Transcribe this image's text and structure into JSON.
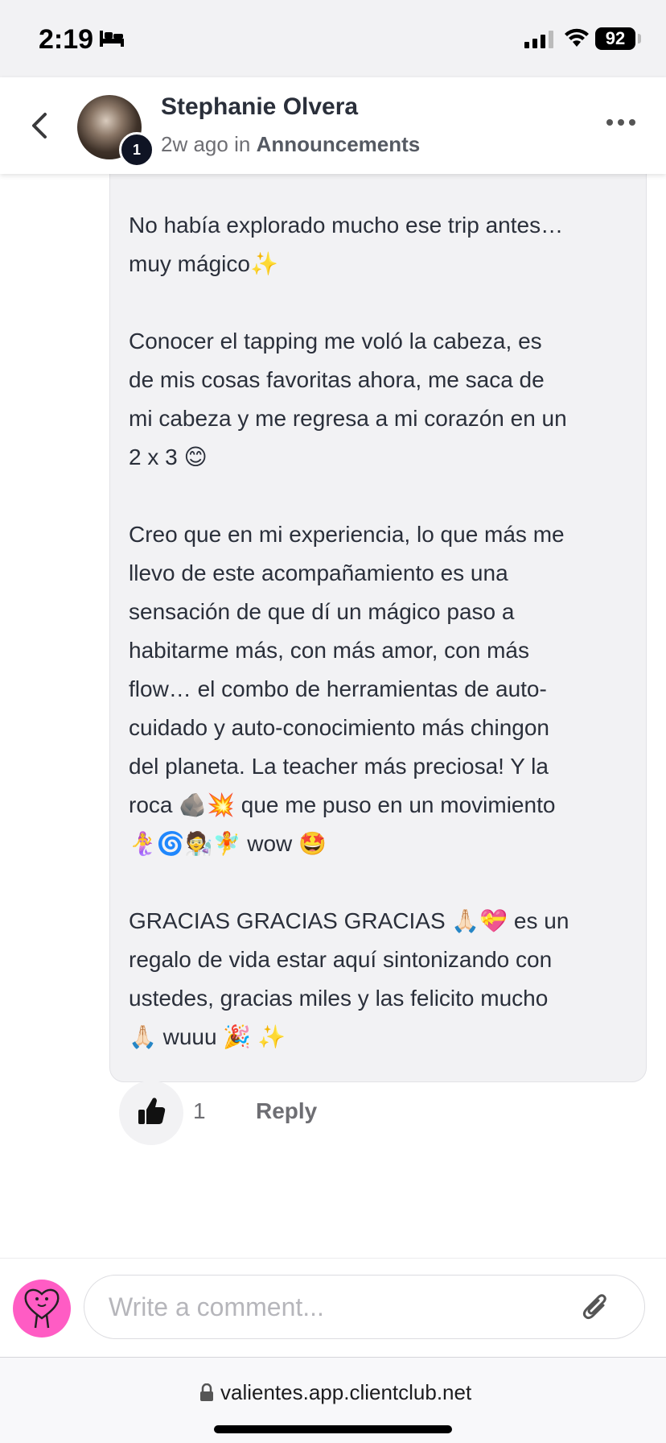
{
  "status_bar": {
    "time": "2:19",
    "battery": "92"
  },
  "header": {
    "author": "Stephanie Olvera",
    "badge": "1",
    "time_ago": "2w ago",
    "in_word": "in",
    "category": "Announcements"
  },
  "comment": {
    "paragraphs": [
      "No había explorado mucho ese trip antes…\nmuy mágico✨",
      "Conocer el tapping me voló la cabeza, es\nde mis cosas favoritas ahora, me saca de\nmi cabeza y me regresa a mi corazón en un\n2 x 3 😊",
      "Creo que en mi experiencia, lo que más me\nllevo de este acompañamiento es una\nsensación de que dí un mágico paso a\nhabitarme más, con más amor, con más\nflow… el combo de herramientas de auto-\ncuidado y auto-conocimiento más chingon\ndel planeta. La teacher más preciosa! Y la\nroca 🪨💥 que me puso en un movimiento\n🧜‍♀️🌀🧑‍🔬🧚 wow 🤩",
      "GRACIAS GRACIAS GRACIAS 🙏🏻💝 es un\nregalo de vida estar aquí sintonizando con\nustedes, gracias miles y las felicito mucho\n🙏🏻 wuuu 🎉 ✨"
    ]
  },
  "actions": {
    "like_count": "1",
    "reply_label": "Reply"
  },
  "composer": {
    "placeholder": "Write a comment..."
  },
  "url_bar": {
    "url": "valientes.app.clientclub.net"
  },
  "colors": {
    "bubble_bg": "#f2f2f4",
    "avatar_pink": "#ff5cc4",
    "badge_bg": "#0f1424"
  }
}
